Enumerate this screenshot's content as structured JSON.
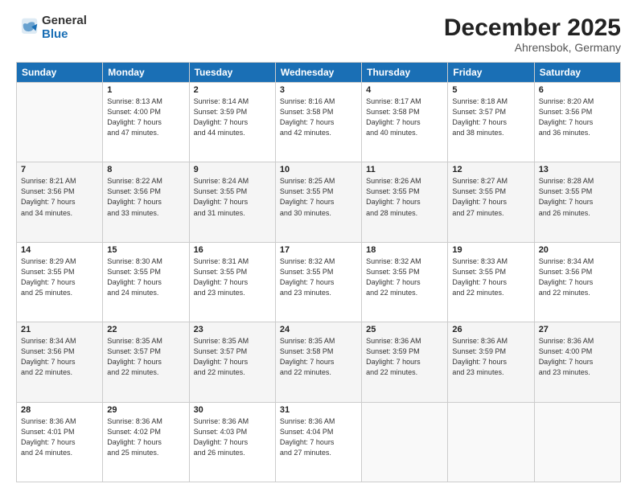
{
  "logo": {
    "general": "General",
    "blue": "Blue"
  },
  "header": {
    "month": "December 2025",
    "location": "Ahrensbok, Germany"
  },
  "weekdays": [
    "Sunday",
    "Monday",
    "Tuesday",
    "Wednesday",
    "Thursday",
    "Friday",
    "Saturday"
  ],
  "weeks": [
    [
      {
        "day": null
      },
      {
        "day": "1",
        "sunrise": "8:13 AM",
        "sunset": "4:00 PM",
        "daylight": "7 hours and 47 minutes."
      },
      {
        "day": "2",
        "sunrise": "8:14 AM",
        "sunset": "3:59 PM",
        "daylight": "7 hours and 44 minutes."
      },
      {
        "day": "3",
        "sunrise": "8:16 AM",
        "sunset": "3:58 PM",
        "daylight": "7 hours and 42 minutes."
      },
      {
        "day": "4",
        "sunrise": "8:17 AM",
        "sunset": "3:58 PM",
        "daylight": "7 hours and 40 minutes."
      },
      {
        "day": "5",
        "sunrise": "8:18 AM",
        "sunset": "3:57 PM",
        "daylight": "7 hours and 38 minutes."
      },
      {
        "day": "6",
        "sunrise": "8:20 AM",
        "sunset": "3:56 PM",
        "daylight": "7 hours and 36 minutes."
      }
    ],
    [
      {
        "day": "7",
        "sunrise": "8:21 AM",
        "sunset": "3:56 PM",
        "daylight": "7 hours and 34 minutes."
      },
      {
        "day": "8",
        "sunrise": "8:22 AM",
        "sunset": "3:56 PM",
        "daylight": "7 hours and 33 minutes."
      },
      {
        "day": "9",
        "sunrise": "8:24 AM",
        "sunset": "3:55 PM",
        "daylight": "7 hours and 31 minutes."
      },
      {
        "day": "10",
        "sunrise": "8:25 AM",
        "sunset": "3:55 PM",
        "daylight": "7 hours and 30 minutes."
      },
      {
        "day": "11",
        "sunrise": "8:26 AM",
        "sunset": "3:55 PM",
        "daylight": "7 hours and 28 minutes."
      },
      {
        "day": "12",
        "sunrise": "8:27 AM",
        "sunset": "3:55 PM",
        "daylight": "7 hours and 27 minutes."
      },
      {
        "day": "13",
        "sunrise": "8:28 AM",
        "sunset": "3:55 PM",
        "daylight": "7 hours and 26 minutes."
      }
    ],
    [
      {
        "day": "14",
        "sunrise": "8:29 AM",
        "sunset": "3:55 PM",
        "daylight": "7 hours and 25 minutes."
      },
      {
        "day": "15",
        "sunrise": "8:30 AM",
        "sunset": "3:55 PM",
        "daylight": "7 hours and 24 minutes."
      },
      {
        "day": "16",
        "sunrise": "8:31 AM",
        "sunset": "3:55 PM",
        "daylight": "7 hours and 23 minutes."
      },
      {
        "day": "17",
        "sunrise": "8:32 AM",
        "sunset": "3:55 PM",
        "daylight": "7 hours and 23 minutes."
      },
      {
        "day": "18",
        "sunrise": "8:32 AM",
        "sunset": "3:55 PM",
        "daylight": "7 hours and 22 minutes."
      },
      {
        "day": "19",
        "sunrise": "8:33 AM",
        "sunset": "3:55 PM",
        "daylight": "7 hours and 22 minutes."
      },
      {
        "day": "20",
        "sunrise": "8:34 AM",
        "sunset": "3:56 PM",
        "daylight": "7 hours and 22 minutes."
      }
    ],
    [
      {
        "day": "21",
        "sunrise": "8:34 AM",
        "sunset": "3:56 PM",
        "daylight": "7 hours and 22 minutes."
      },
      {
        "day": "22",
        "sunrise": "8:35 AM",
        "sunset": "3:57 PM",
        "daylight": "7 hours and 22 minutes."
      },
      {
        "day": "23",
        "sunrise": "8:35 AM",
        "sunset": "3:57 PM",
        "daylight": "7 hours and 22 minutes."
      },
      {
        "day": "24",
        "sunrise": "8:35 AM",
        "sunset": "3:58 PM",
        "daylight": "7 hours and 22 minutes."
      },
      {
        "day": "25",
        "sunrise": "8:36 AM",
        "sunset": "3:59 PM",
        "daylight": "7 hours and 22 minutes."
      },
      {
        "day": "26",
        "sunrise": "8:36 AM",
        "sunset": "3:59 PM",
        "daylight": "7 hours and 23 minutes."
      },
      {
        "day": "27",
        "sunrise": "8:36 AM",
        "sunset": "4:00 PM",
        "daylight": "7 hours and 23 minutes."
      }
    ],
    [
      {
        "day": "28",
        "sunrise": "8:36 AM",
        "sunset": "4:01 PM",
        "daylight": "7 hours and 24 minutes."
      },
      {
        "day": "29",
        "sunrise": "8:36 AM",
        "sunset": "4:02 PM",
        "daylight": "7 hours and 25 minutes."
      },
      {
        "day": "30",
        "sunrise": "8:36 AM",
        "sunset": "4:03 PM",
        "daylight": "7 hours and 26 minutes."
      },
      {
        "day": "31",
        "sunrise": "8:36 AM",
        "sunset": "4:04 PM",
        "daylight": "7 hours and 27 minutes."
      },
      {
        "day": null
      },
      {
        "day": null
      },
      {
        "day": null
      }
    ]
  ],
  "labels": {
    "sunrise": "Sunrise:",
    "sunset": "Sunset:",
    "daylight": "Daylight:"
  }
}
